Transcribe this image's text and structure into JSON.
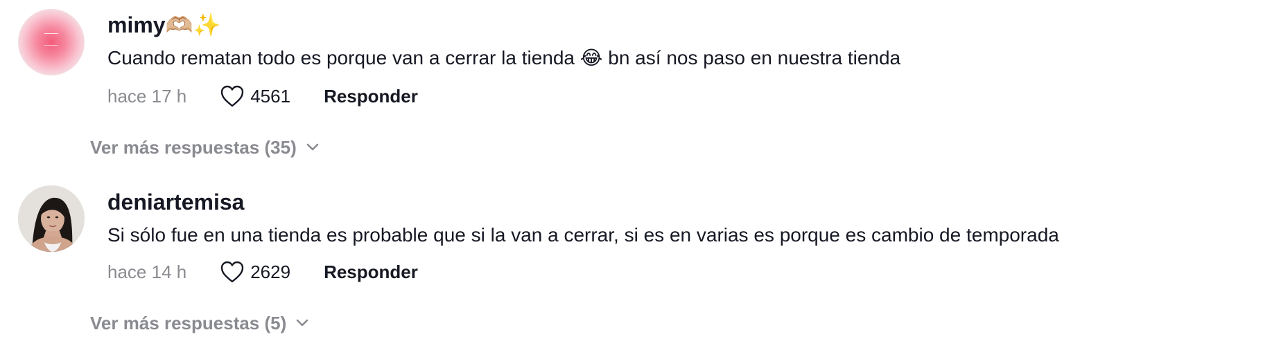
{
  "comments": [
    {
      "username": "mimy🫶🏼✨",
      "text": "Cuando rematan todo es porque van a cerrar la tienda 😂 bn así nos paso en nuestra tienda",
      "time": "hace 17 h",
      "likes": "4561",
      "reply_label": "Responder",
      "more_replies": "Ver más respuestas (35)"
    },
    {
      "username": "deniartemisa",
      "text": "Si sólo fue en una tienda es probable que si la van a cerrar, si es en varias es porque es cambio de temporada",
      "time": "hace 14 h",
      "likes": "2629",
      "reply_label": "Responder",
      "more_replies": "Ver más respuestas (5)"
    }
  ],
  "icons": {
    "like": "heart-outline-icon",
    "expand": "chevron-down-icon"
  },
  "colors": {
    "text": "#161823",
    "muted": "#8a8b91",
    "background": "#ffffff"
  }
}
